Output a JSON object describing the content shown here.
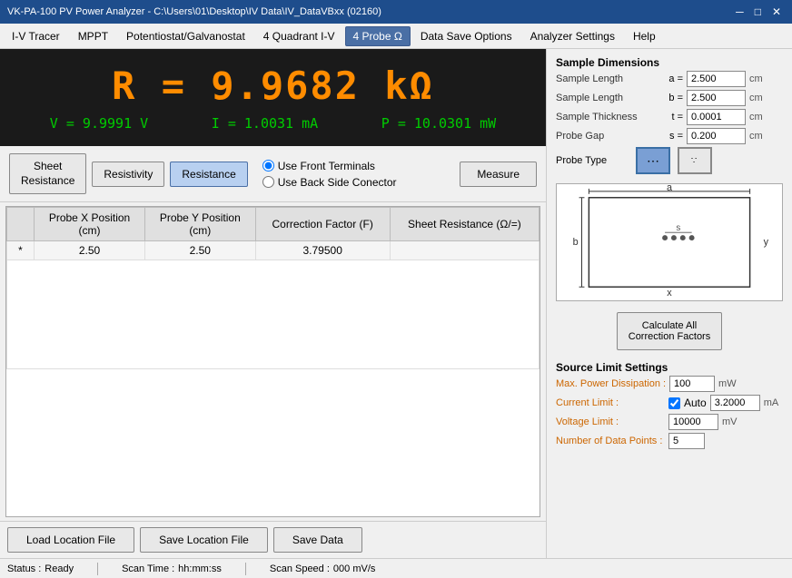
{
  "titleBar": {
    "title": "VK-PA-100 PV Power Analyzer - C:\\Users\\01\\Desktop\\IV Data\\IV_DataVBxx (02160)",
    "minBtn": "─",
    "maxBtn": "□",
    "closeBtn": "✕"
  },
  "menuBar": {
    "items": [
      {
        "id": "iv-tracer",
        "label": "I-V Tracer",
        "active": false
      },
      {
        "id": "mppt",
        "label": "MPPT",
        "active": false
      },
      {
        "id": "potentiostat",
        "label": "Potentiostat/Galvanostat",
        "active": false
      },
      {
        "id": "4-quadrant",
        "label": "4 Quadrant I-V",
        "active": false
      },
      {
        "id": "4-probe",
        "label": "4 Probe Ω",
        "active": true
      },
      {
        "id": "data-save",
        "label": "Data Save Options",
        "active": false
      },
      {
        "id": "analyzer",
        "label": "Analyzer Settings",
        "active": false
      },
      {
        "id": "help",
        "label": "Help",
        "active": false
      }
    ]
  },
  "display": {
    "resistance": "R = 9.9682 kΩ",
    "voltage": "V =   9.9991 V",
    "current": "I =   1.0031 mA",
    "power": "P =   10.0301 mW"
  },
  "controls": {
    "sheetResistanceBtn": "Sheet\nResistance",
    "resistivityBtn": "Resistivity",
    "resistanceBtn": "Resistance",
    "measureBtn": "Measure",
    "radioFront": "Use Front Terminals",
    "radioBack": "Use Back Side Conector"
  },
  "table": {
    "columns": [
      "",
      "Probe X Position\n(cm)",
      "Probe Y Position\n(cm)",
      "Correction Factor (F)",
      "Sheet Resistance (Ω/=)"
    ],
    "rows": [
      {
        "marker": "*",
        "probeX": "2.50",
        "probeY": "2.50",
        "corrFactor": "3.79500",
        "sheetRes": ""
      }
    ]
  },
  "bottomButtons": {
    "loadLabel": "Load Location File",
    "saveLabel": "Save Location File",
    "saveDataLabel": "Save Data"
  },
  "rightPanel": {
    "sampleDimTitle": "Sample Dimensions",
    "fields": [
      {
        "label": "Sample Length",
        "eq": "a =",
        "value": "2.500",
        "unit": "cm"
      },
      {
        "label": "Sample Length",
        "eq": "b =",
        "value": "2.500",
        "unit": "cm"
      },
      {
        "label": "Sample Thickness",
        "eq": "t =",
        "value": "0.0001",
        "unit": "cm"
      },
      {
        "label": "Probe Gap",
        "eq": "s =",
        "value": "0.200",
        "unit": "cm"
      }
    ],
    "probeTypeLabel": "Probe Type",
    "probeButtons": [
      {
        "id": "inline",
        "symbol": "⋯",
        "active": true
      },
      {
        "id": "square",
        "symbol": "⁚",
        "active": false
      }
    ],
    "calcBtn": "Calculate All\nCorrection Factors",
    "sourceLimitTitle": "Source Limit Settings",
    "sourceLimitFields": [
      {
        "label": "Max. Power Dissipation :",
        "value": "100",
        "unit": "mW"
      },
      {
        "label": "Current Limit :",
        "value": "3.2000",
        "unit": "mA",
        "hasAuto": true,
        "autoChecked": true
      },
      {
        "label": "Voltage Limit :",
        "value": "10000",
        "unit": "mV"
      },
      {
        "label": "Number of Data Points :",
        "value": "5",
        "unit": ""
      }
    ]
  },
  "statusBar": {
    "statusLabel": "Status :",
    "statusValue": "Ready",
    "scanTimeLabel": "Scan Time :",
    "scanTimeValue": "hh:mm:ss",
    "scanSpeedLabel": "Scan Speed :",
    "scanSpeedValue": "000 mV/s"
  }
}
